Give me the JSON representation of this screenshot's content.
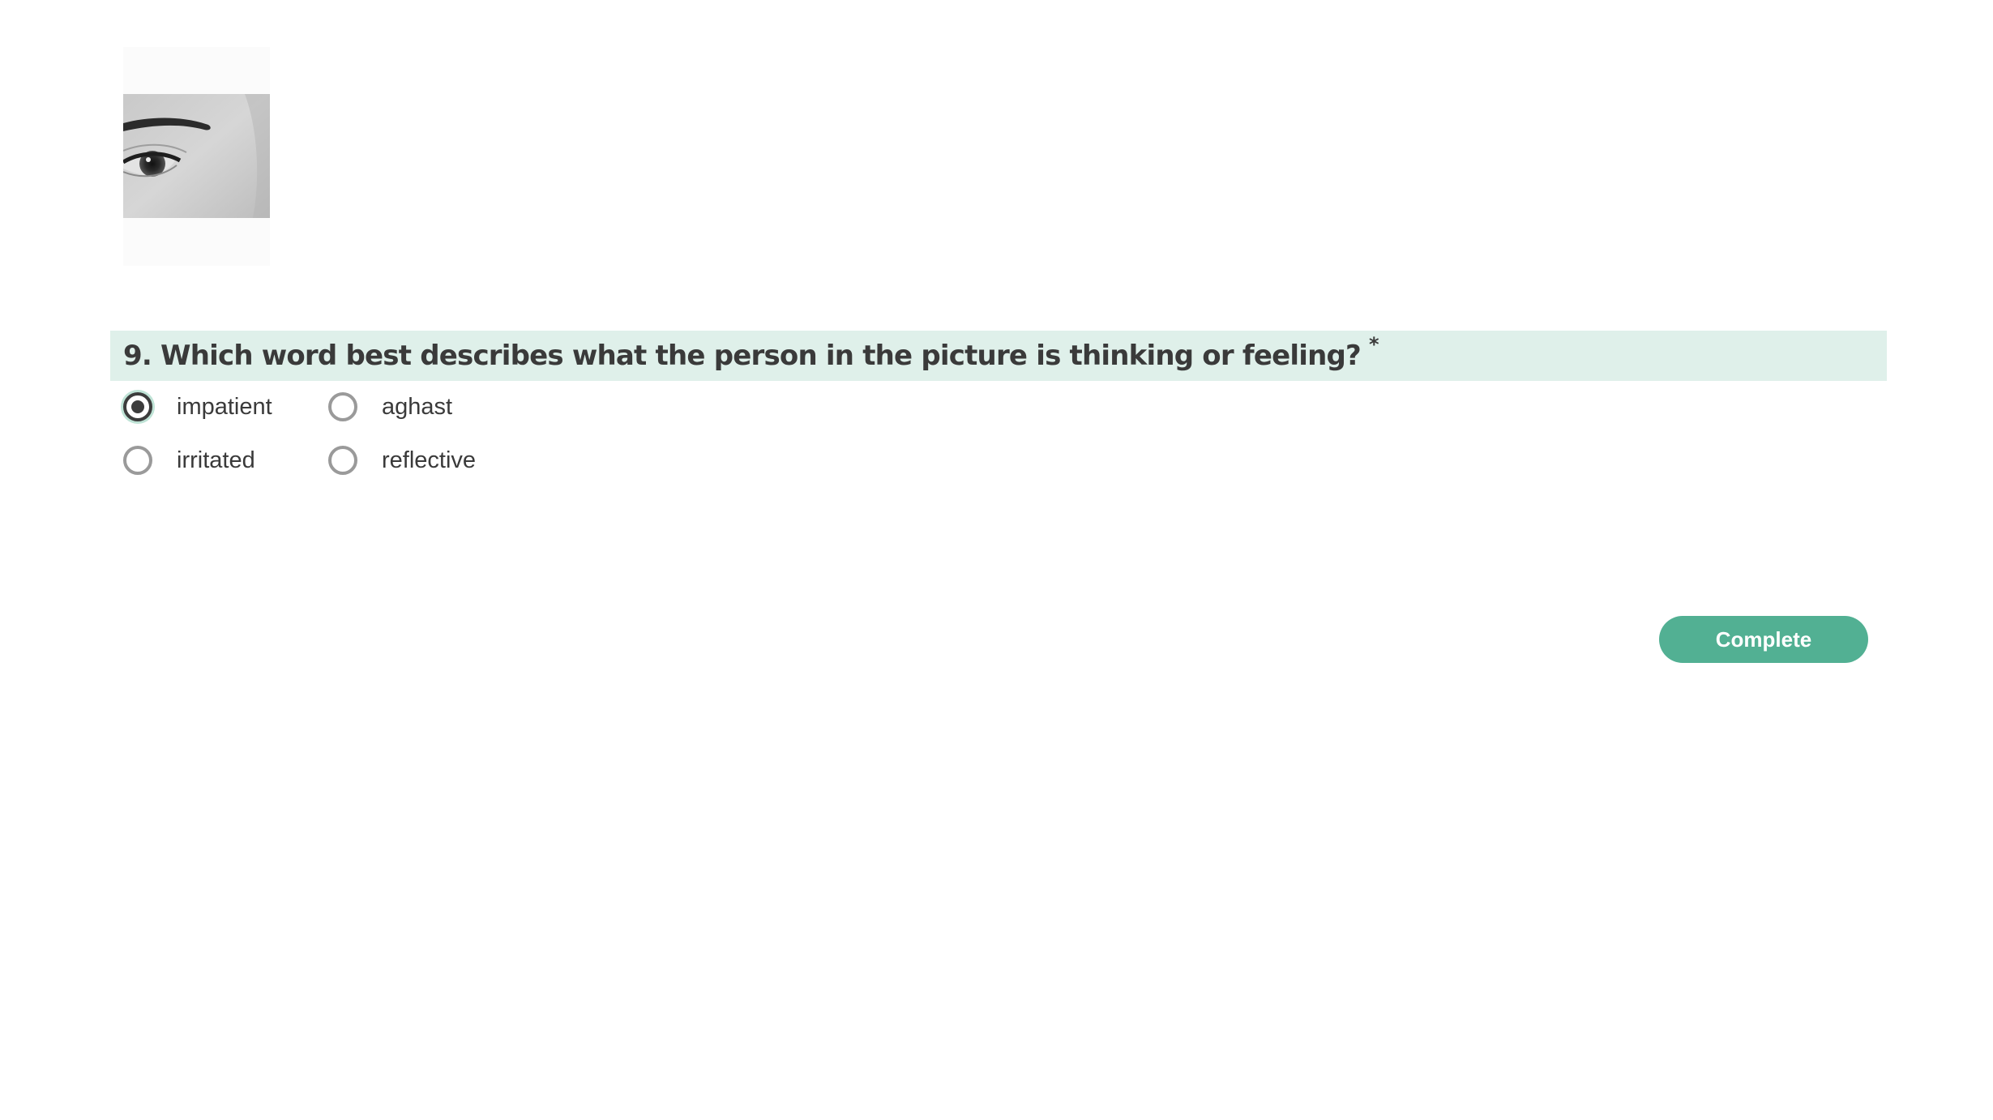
{
  "question": {
    "title": "9. Which word best describes what the person in the picture is thinking or feeling?",
    "required_marker": "*",
    "image_icon": "eye-photo",
    "options": [
      {
        "label": "impatient",
        "selected": true
      },
      {
        "label": "aghast",
        "selected": false
      },
      {
        "label": "irritated",
        "selected": false
      },
      {
        "label": "reflective",
        "selected": false
      }
    ]
  },
  "actions": {
    "complete_label": "Complete"
  },
  "colors": {
    "question_bar": "#dff0ea",
    "accent": "#52b093",
    "text": "#3a3a3a"
  }
}
